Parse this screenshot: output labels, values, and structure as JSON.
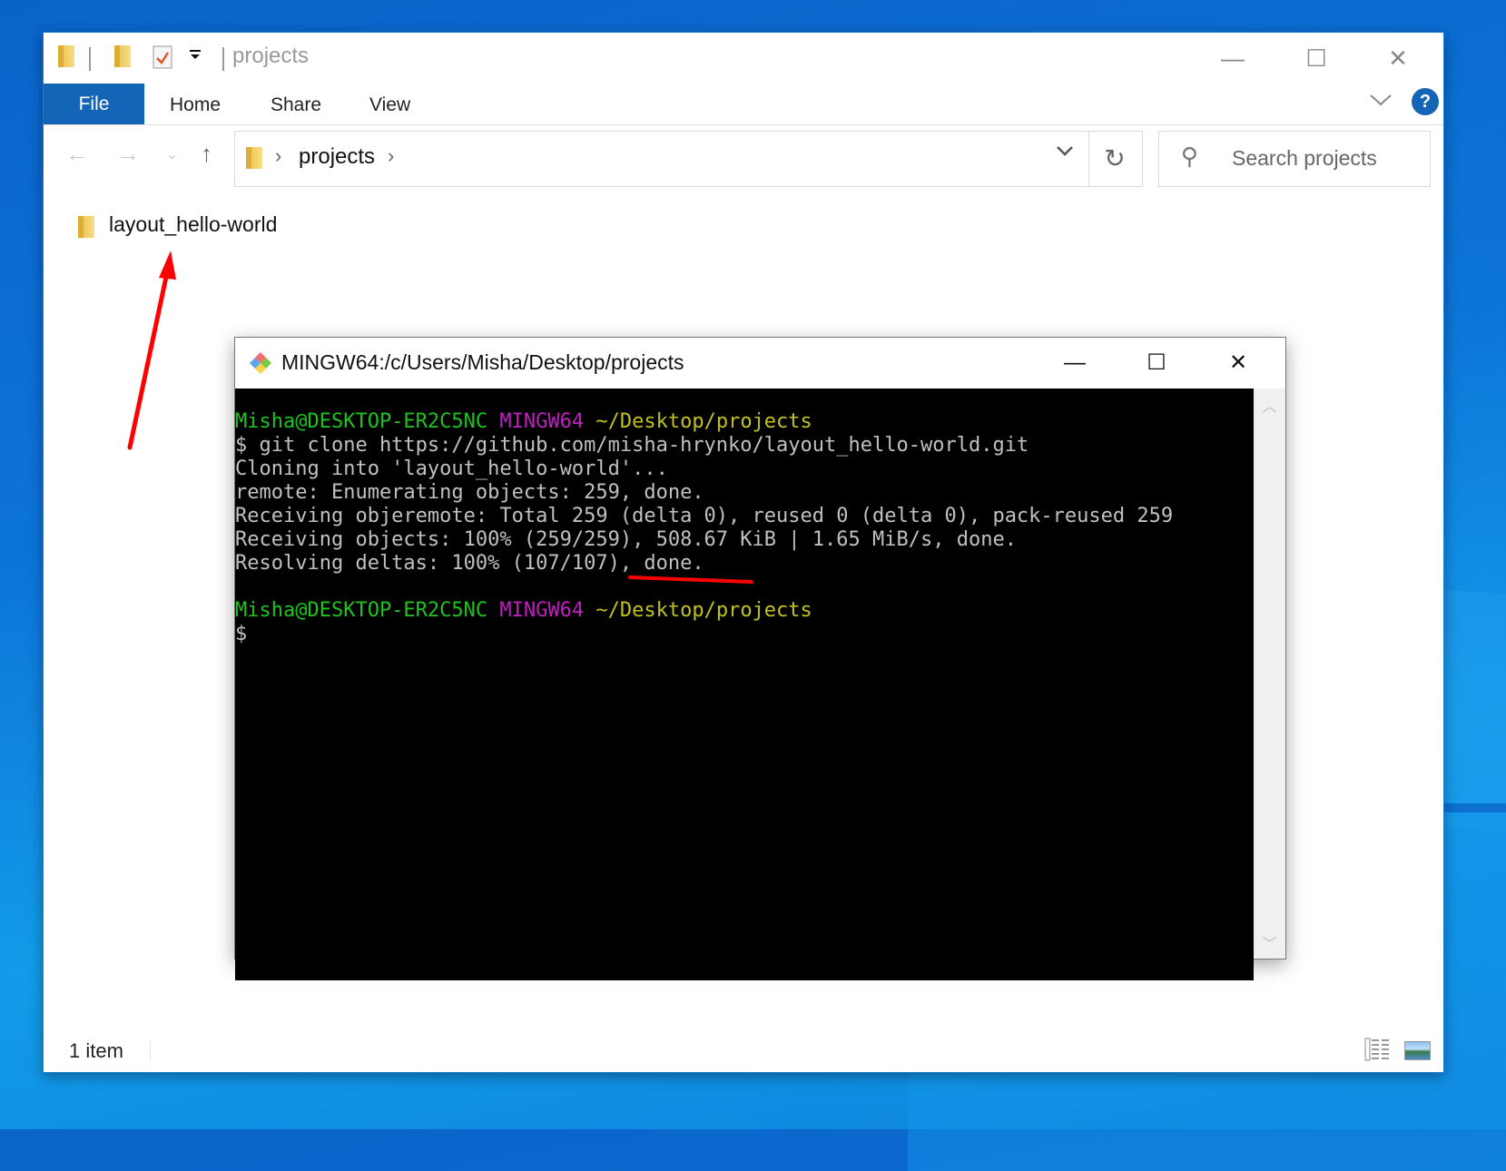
{
  "explorer": {
    "window_title": "projects",
    "ribbon_tabs": {
      "file": "File",
      "home": "Home",
      "share": "Share",
      "view": "View"
    },
    "address": {
      "crumb": "projects"
    },
    "search": {
      "placeholder": "Search projects"
    },
    "items": [
      {
        "name": "layout_hello-world",
        "type": "folder"
      }
    ],
    "status": {
      "item_count": "1 item"
    },
    "window_buttons": {
      "minimize": "—",
      "maximize": "☐",
      "close": "✕"
    }
  },
  "terminal": {
    "title": "MINGW64:/c/Users/Misha/Desktop/projects",
    "prompt": {
      "user_host": "Misha@DESKTOP-ER2C5NC",
      "env": "MINGW64",
      "path": "~/Desktop/projects"
    },
    "lines": [
      "$ git clone https://github.com/misha-hrynko/layout_hello-world.git",
      "Cloning into 'layout_hello-world'...",
      "remote: Enumerating objects: 259, done.",
      "Receiving objeremote: Total 259 (delta 0), reused 0 (delta 0), pack-reused 259",
      "Receiving objects: 100% (259/259), 508.67 KiB | 1.65 MiB/s, done.",
      "Resolving deltas: 100% (107/107), done."
    ],
    "final_prompt_symbol": "$"
  },
  "annotations": {
    "color": "#ff0000"
  }
}
